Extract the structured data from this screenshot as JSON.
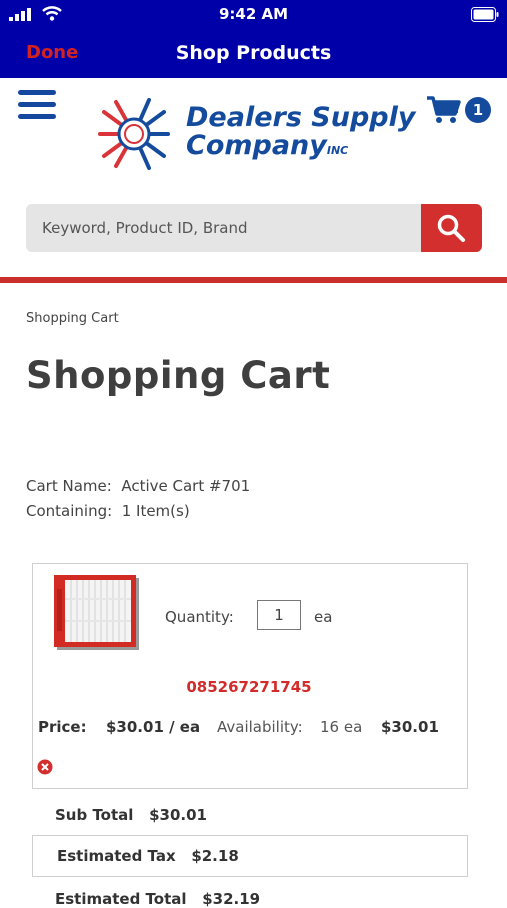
{
  "status": {
    "time": "9:42 AM"
  },
  "nav": {
    "done_label": "Done",
    "title": "Shop Products"
  },
  "logo": {
    "line1": "Dealers Supply",
    "line2": "Company",
    "inc": "INC"
  },
  "cart": {
    "count": "1"
  },
  "search": {
    "placeholder": "Keyword, Product ID, Brand",
    "value": ""
  },
  "breadcrumb": "Shopping Cart",
  "page_title": "Shopping Cart",
  "cart_info": {
    "name_label": "Cart Name:",
    "name_value": "Active Cart #701",
    "containing_label": "Containing:",
    "containing_value": "1 Item(s)"
  },
  "item": {
    "quantity_label": "Quantity:",
    "quantity_value": "1",
    "unit": "ea",
    "part_number": "085267271745",
    "price_label": "Price:",
    "price_value": "$30.01 / ea",
    "availability_label": "Availability:",
    "availability_value": "16 ea",
    "line_total": "$30.01"
  },
  "totals": {
    "subtotal_label": "Sub Total",
    "subtotal_value": "$30.01",
    "tax_label": "Estimated Tax",
    "tax_value": "$2.18",
    "total_label": "Estimated Total",
    "total_value": "$32.19"
  },
  "colors": {
    "nav": "#0000a8",
    "brand_blue": "#144b9d",
    "accent_red": "#d32f2f"
  },
  "icons": [
    "signal-icon",
    "wifi-icon",
    "battery-icon",
    "menu-icon",
    "cart-icon",
    "search-icon",
    "remove-icon"
  ]
}
